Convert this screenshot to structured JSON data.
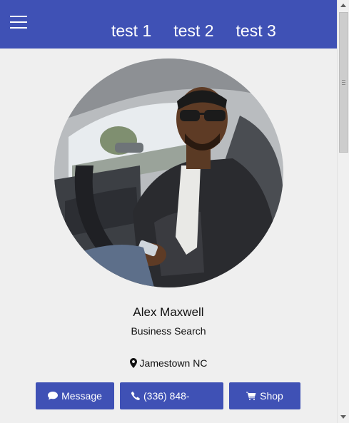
{
  "nav": {
    "menu_icon": "hamburger-menu-icon",
    "links": [
      "test 1",
      "test 2",
      "test 3"
    ],
    "bg_color": "#3f51b5"
  },
  "profile": {
    "name": "Alex Maxwell",
    "subtitle": "Business Search",
    "location": "Jamestown NC",
    "location_icon": "map-marker-icon"
  },
  "actions": {
    "message_label": "Message",
    "message_icon": "comment-icon",
    "phone_label": "(336) 848-",
    "phone_icon": "phone-icon",
    "shop_label": "Shop",
    "shop_icon": "shopping-cart-icon",
    "button_color": "#3f51b5"
  }
}
